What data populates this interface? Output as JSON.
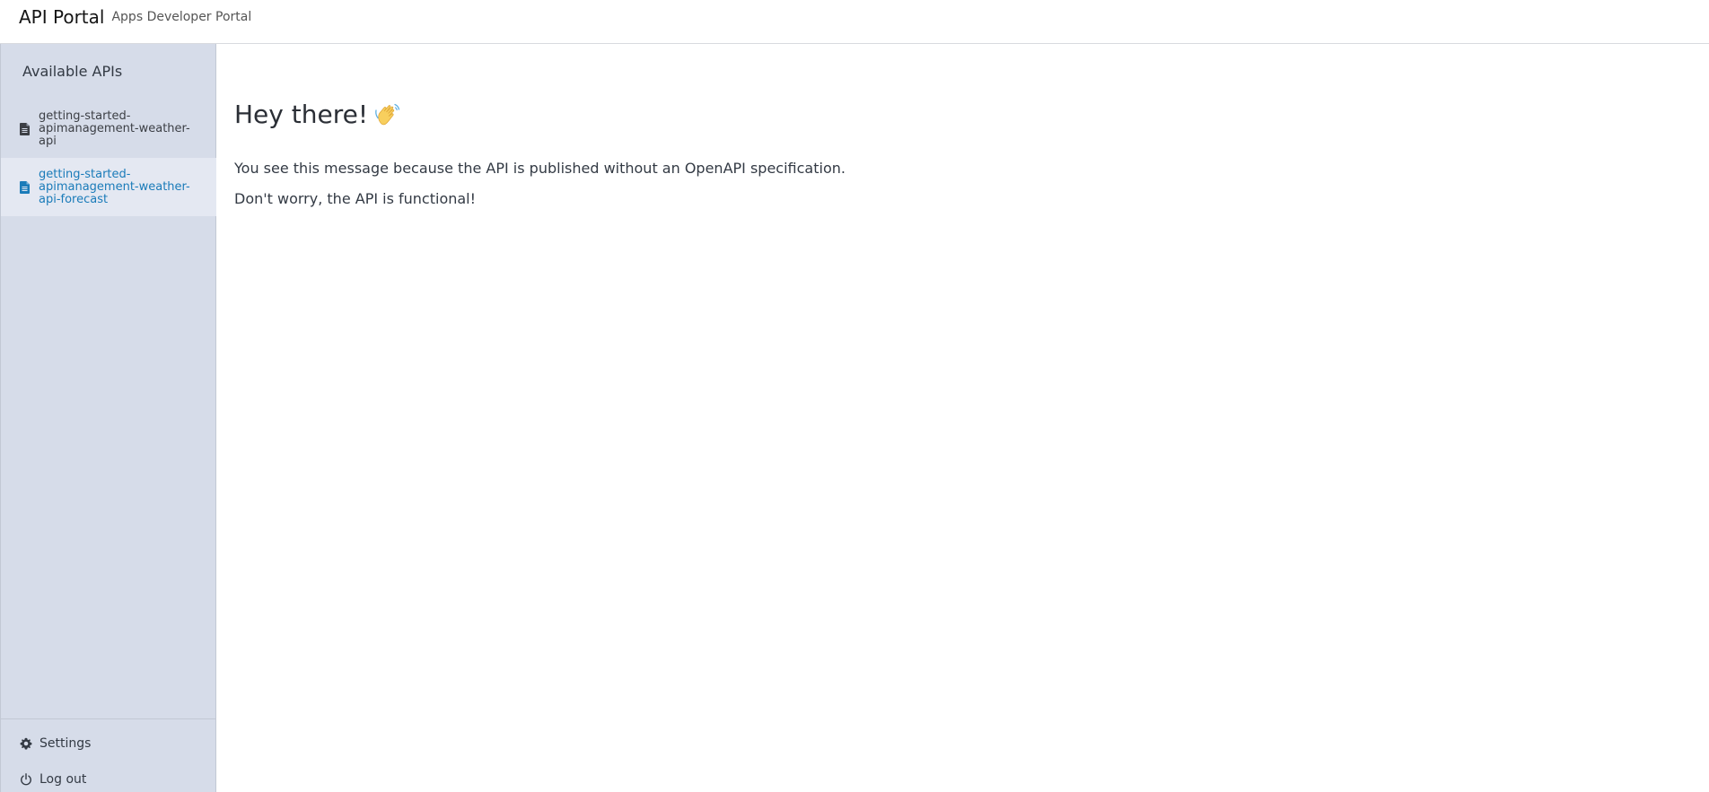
{
  "header": {
    "title": "API Portal",
    "subtitle": "Apps Developer Portal"
  },
  "sidebar": {
    "heading": "Available APIs",
    "items": [
      {
        "label": "getting-started-apimanagement-weather-api",
        "icon": "document-icon",
        "active": false
      },
      {
        "label": "getting-started-apimanagement-weather-api-forecast",
        "icon": "document-icon",
        "active": true
      }
    ],
    "footer": {
      "settings_label": "Settings",
      "logout_label": "Log out"
    }
  },
  "main": {
    "greeting": "Hey there!",
    "greeting_icon": "waving-hand-icon",
    "messages": [
      "You see this message because the API is published without an OpenAPI specification.",
      "Don't worry, the API is functional!"
    ]
  },
  "colors": {
    "sidebar_bg": "#d6dce9",
    "active_item_bg": "#e4e8f2",
    "active_link": "#1a7bb9"
  }
}
